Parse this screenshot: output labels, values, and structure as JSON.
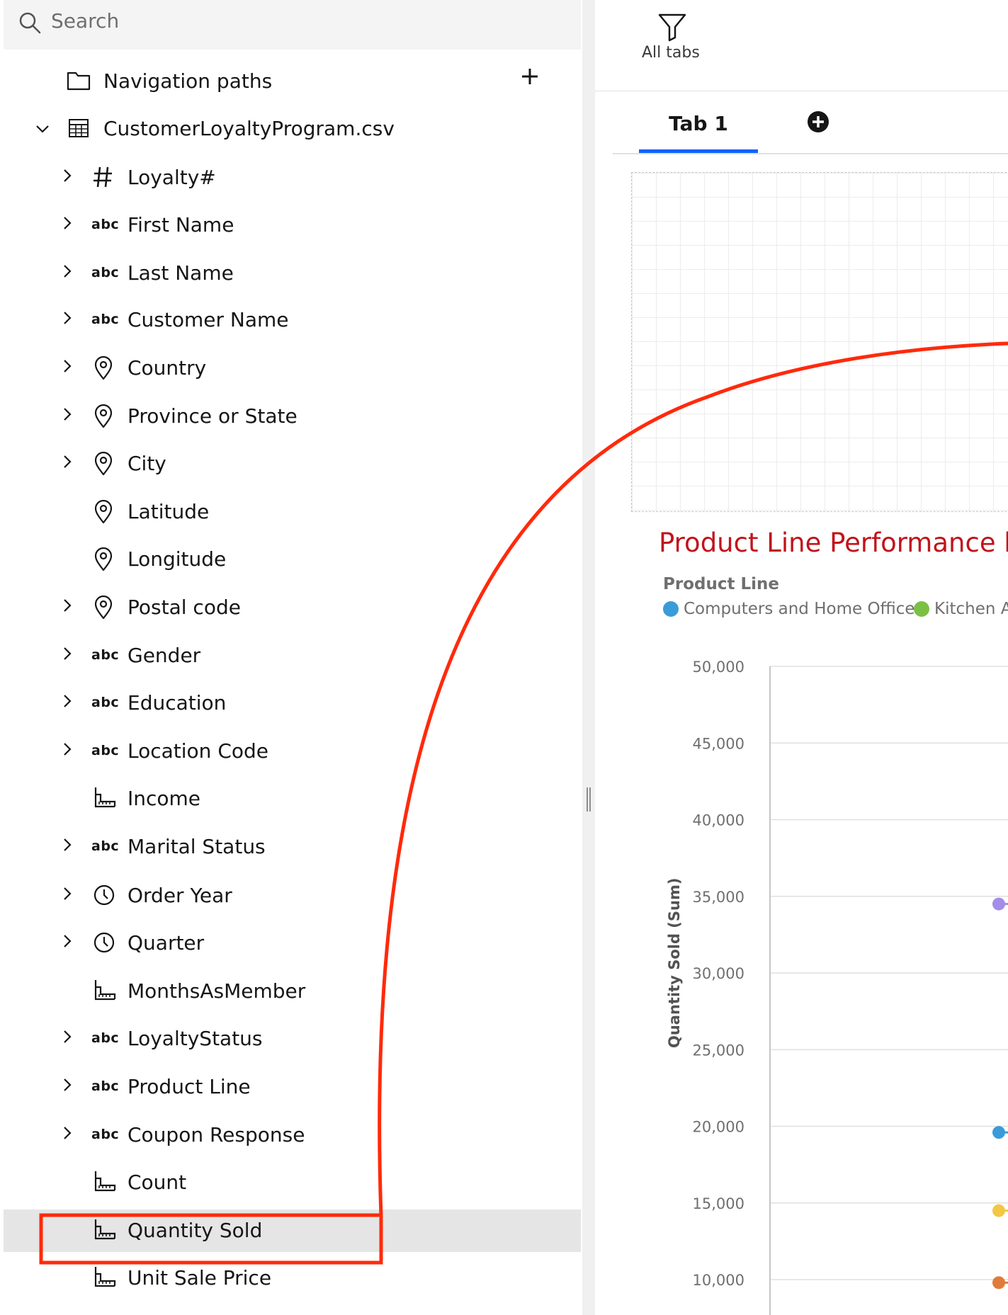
{
  "search": {
    "placeholder": "Search"
  },
  "data_tree": {
    "navigation_paths_label": "Navigation paths",
    "source_file": "CustomerLoyaltyProgram.csv",
    "fields": [
      {
        "label": "Loyalty#",
        "type": "number",
        "expandable": true
      },
      {
        "label": "First Name",
        "type": "text",
        "expandable": true
      },
      {
        "label": "Last Name",
        "type": "text",
        "expandable": true
      },
      {
        "label": "Customer Name",
        "type": "text",
        "expandable": true
      },
      {
        "label": "Country",
        "type": "location",
        "expandable": true
      },
      {
        "label": "Province or State",
        "type": "location",
        "expandable": true
      },
      {
        "label": "City",
        "type": "location",
        "expandable": true
      },
      {
        "label": "Latitude",
        "type": "location",
        "expandable": false
      },
      {
        "label": "Longitude",
        "type": "location",
        "expandable": false
      },
      {
        "label": "Postal code",
        "type": "location",
        "expandable": true
      },
      {
        "label": "Gender",
        "type": "text",
        "expandable": true
      },
      {
        "label": "Education",
        "type": "text",
        "expandable": true
      },
      {
        "label": "Location Code",
        "type": "text",
        "expandable": true
      },
      {
        "label": "Income",
        "type": "measure",
        "expandable": false
      },
      {
        "label": "Marital Status",
        "type": "text",
        "expandable": true
      },
      {
        "label": "Order Year",
        "type": "time",
        "expandable": true
      },
      {
        "label": "Quarter",
        "type": "time",
        "expandable": true
      },
      {
        "label": "MonthsAsMember",
        "type": "measure",
        "expandable": false
      },
      {
        "label": "LoyaltyStatus",
        "type": "text",
        "expandable": true
      },
      {
        "label": "Product Line",
        "type": "text",
        "expandable": true
      },
      {
        "label": "Coupon Response",
        "type": "text",
        "expandable": true
      },
      {
        "label": "Count",
        "type": "measure",
        "expandable": false
      },
      {
        "label": "Quantity Sold",
        "type": "measure",
        "expandable": false,
        "selected": true
      },
      {
        "label": "Unit Sale Price",
        "type": "measure",
        "expandable": false
      }
    ],
    "type_badge_text": "abc"
  },
  "toolbar": {
    "filter_label": "All tabs"
  },
  "tabs": [
    {
      "label": "Tab 1",
      "active": true
    }
  ],
  "chart_data": {
    "type": "line",
    "title": "Product Line Performance by",
    "legend_title": "Product Line",
    "legend_placement": "top-left",
    "ylabel": "Quantity Sold (Sum)",
    "ylim": [
      10000,
      50000
    ],
    "y_ticks": [
      "50,000",
      "45,000",
      "40,000",
      "35,000",
      "30,000",
      "25,000",
      "20,000",
      "15,000",
      "10,000"
    ],
    "y_tick_values": [
      50000,
      45000,
      40000,
      35000,
      30000,
      25000,
      20000,
      15000,
      10000
    ],
    "grid": true,
    "series": [
      {
        "name": "Computers and Home Office",
        "color": "#3a9bd9",
        "values": [
          19600
        ]
      },
      {
        "name": "Kitchen A",
        "color": "#7ac143",
        "values": []
      }
    ],
    "partial_visible_points": [
      {
        "color": "#a48ce8",
        "value": 34500
      },
      {
        "color": "#3a9bd9",
        "value": 19600
      },
      {
        "color": "#f2c744",
        "value": 14500
      },
      {
        "color": "#e07b39",
        "value": 9800
      }
    ]
  },
  "colors": {
    "annotation": "#ff2a0b",
    "tab_accent": "#0f62fe",
    "chart_title": "#c0141c"
  }
}
